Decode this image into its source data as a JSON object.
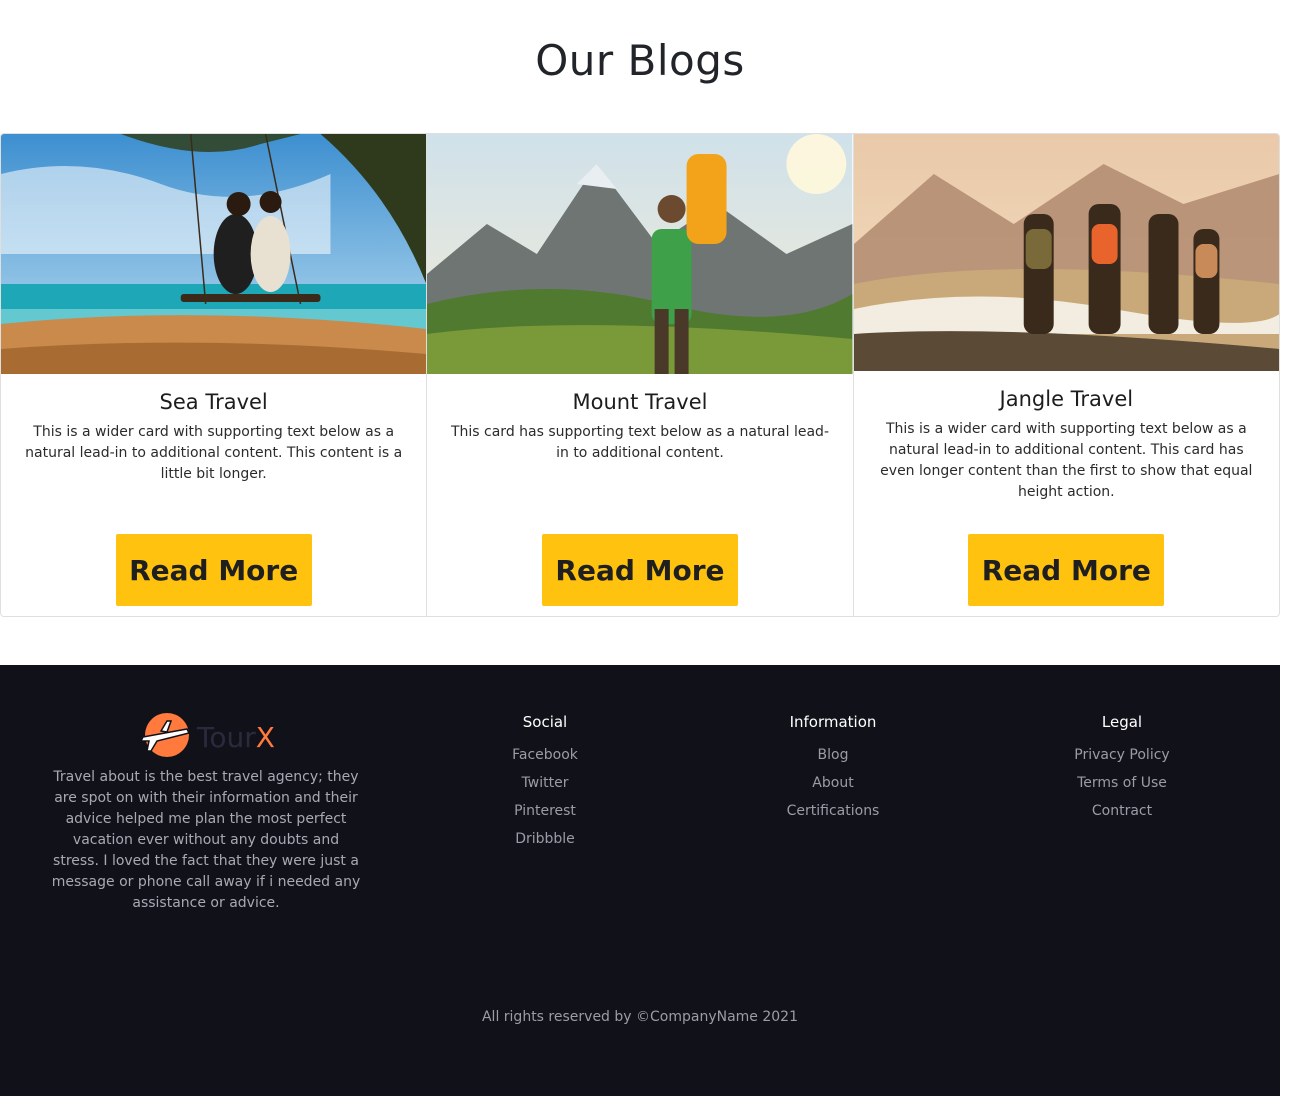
{
  "section": {
    "title": "Our Blogs"
  },
  "cards": [
    {
      "title": "Sea Travel",
      "text": "This is a wider card with supporting text below as a natural lead-in to additional content. This content is a little bit longer.",
      "button": "Read More",
      "image": "couple-on-beach-swing-image"
    },
    {
      "title": "Mount Travel",
      "text": "This card has supporting text below as a natural lead-in to additional content.",
      "button": "Read More",
      "image": "hiker-in-mountains-image"
    },
    {
      "title": "Jangle Travel",
      "text": "This is a wider card with supporting text below as a natural lead-in to additional content. This card has even longer content than the first to show that equal height action.",
      "button": "Read More",
      "image": "group-overlooking-valley-image"
    }
  ],
  "footer": {
    "brand": {
      "logo_icon": "plane-logo-icon",
      "name_part1": "Tour",
      "name_part2": "X",
      "text": "Travel about is the best travel agency; they are spot on with their information and their advice helped me plan the most perfect vacation ever without any doubts and stress. I loved the fact that they were just a message or phone call away if i needed any assistance or advice."
    },
    "social": {
      "heading": "Social",
      "links": [
        "Facebook",
        "Twitter",
        "Pinterest",
        "Dribbble"
      ]
    },
    "information": {
      "heading": "Information",
      "links": [
        "Blog",
        "About",
        "Certifications"
      ]
    },
    "legal": {
      "heading": "Legal",
      "links": [
        "Privacy Policy",
        "Terms of Use",
        "Contract"
      ]
    },
    "copyright": "All rights reserved by ©CompanyName 2021"
  },
  "colors": {
    "accent": "#fec20f",
    "footer_bg": "#11111a",
    "logo_orange": "#ff7a3c"
  }
}
